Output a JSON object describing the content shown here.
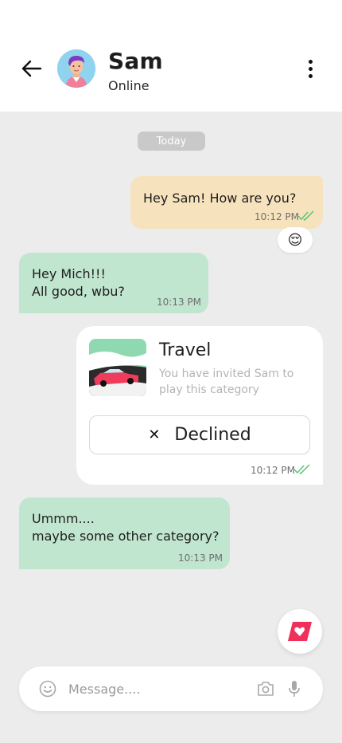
{
  "header": {
    "name": "Sam",
    "status": "Online"
  },
  "date_chip": "Today",
  "messages": [
    {
      "text": "Hey Sam! How are you?",
      "time": "10:12 PM",
      "reaction": "😌"
    },
    {
      "text_line1": "Hey Mich!!!",
      "text_line2": "All good, wbu?",
      "time": "10:13 PM"
    },
    {
      "card_title": "Travel",
      "card_subtitle": "You have invited Sam to play this category",
      "status_label": "Declined",
      "time": "10:12 PM"
    },
    {
      "text_line1": "Ummm....",
      "text_line2": "maybe some other category?",
      "time": "10:13 PM"
    }
  ],
  "composer": {
    "placeholder": "Message...."
  },
  "colors": {
    "sent_bubble": "#f6e3bd",
    "received_bubble": "#c1e6cf",
    "read_ticks": "#4cc36b",
    "fab_accent": "#f0305a"
  },
  "icons": {
    "back": "arrow-left-icon",
    "more": "more-vertical-icon",
    "emoji": "smiley-icon",
    "camera": "camera-icon",
    "mic": "microphone-icon",
    "fab": "heart-card-icon"
  }
}
